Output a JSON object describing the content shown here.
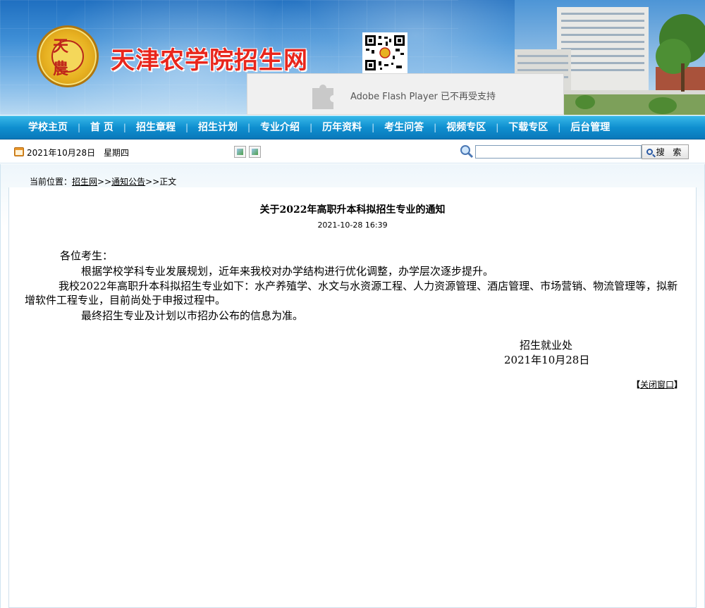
{
  "header": {
    "site_title": "天津农学院招生网",
    "logo_mark": "天農",
    "flash_notice": "Adobe Flash Player 已不再受支持"
  },
  "nav": {
    "items": [
      "学校主页",
      "首 页",
      "招生章程",
      "招生计划",
      "专业介绍",
      "历年资料",
      "考生问答",
      "视频专区",
      "下载专区",
      "后台管理"
    ]
  },
  "datebar": {
    "date": "2021年10月28日",
    "weekday": "星期四",
    "search_value": "",
    "search_button": "搜 索"
  },
  "breadcrumb": {
    "prefix": "当前位置：",
    "home": "招生网",
    "sep1": ">>",
    "section": "通知公告",
    "sep2": ">>",
    "current": "正文"
  },
  "article": {
    "title": "关于2022年高职升本科拟招生专业的通知",
    "time": "2021-10-28 16:39",
    "greeting": "各位考生：",
    "para1": "根据学校学科专业发展规划，近年来我校对办学结构进行优化调整，办学层次逐步提升。",
    "para2": "我校2022年高职升本科拟招生专业如下：水产养殖学、水文与水资源工程、人力资源管理、酒店管理、市场营销、物流管理等，拟新增软件工程专业，目前尚处于申报过程中。",
    "para3": "最终招生专业及计划以市招办公布的信息为准。",
    "signature_dept": "招生就业处",
    "signature_date": "2021年10月28日"
  },
  "footer": {
    "close_open": "【",
    "close_label": "关闭窗口",
    "close_close": "】"
  },
  "colors": {
    "nav_bg": "#0f8fd0",
    "title_red": "#e8261c"
  }
}
